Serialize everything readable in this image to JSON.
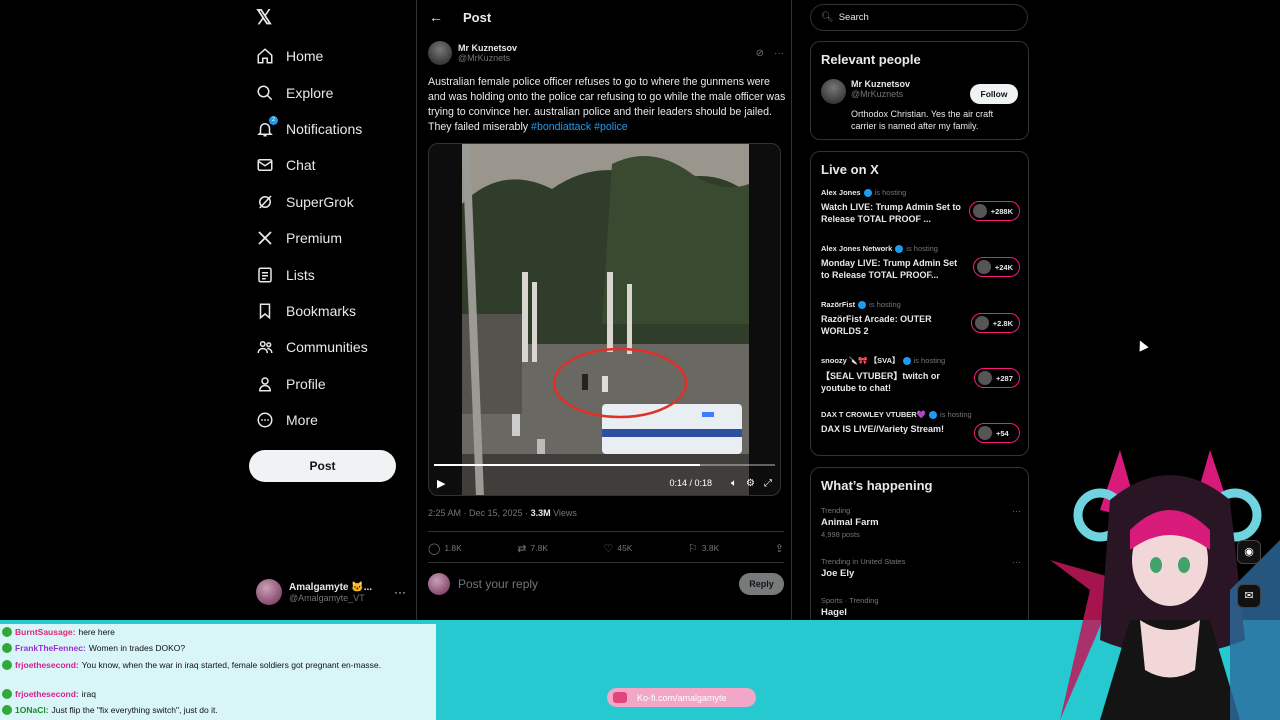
{
  "nav": {
    "logo": "𝕏",
    "items": [
      {
        "label": "Home",
        "icon": "home-icon"
      },
      {
        "label": "Explore",
        "icon": "search-icon"
      },
      {
        "label": "Notifications",
        "icon": "bell-icon",
        "badge": "2"
      },
      {
        "label": "Chat",
        "icon": "mail-icon"
      },
      {
        "label": "SuperGrok",
        "icon": "grok-icon"
      },
      {
        "label": "Premium",
        "icon": "x-icon"
      },
      {
        "label": "Lists",
        "icon": "list-icon"
      },
      {
        "label": "Bookmarks",
        "icon": "bookmark-icon"
      },
      {
        "label": "Communities",
        "icon": "people-icon"
      },
      {
        "label": "Profile",
        "icon": "person-icon"
      },
      {
        "label": "More",
        "icon": "more-circle-icon"
      }
    ],
    "post_button": "Post",
    "account": {
      "name": "Amalgamyte 🐱...",
      "handle": "@Amalgamyte_VT"
    }
  },
  "post": {
    "header_title": "Post",
    "author_name": "Mr Kuznetsov",
    "author_handle": "@MrKuznets",
    "text": "Australian female police officer refuses to go to where the gunmens were and was holding onto the police car refusing to go while the male officer was trying to convince her. australian police and their leaders should be jailed. They failed miserably ",
    "hashtags": [
      "#bondiattack",
      "#police"
    ],
    "video": {
      "time": "0:14 / 0:18",
      "progress": 0.78
    },
    "timestamp": "2:25 AM · Dec 15, 2025 · ",
    "views_count": "3.3M",
    "views_label": " Views",
    "stats": {
      "replies": "1.8K",
      "reposts": "7.8K",
      "likes": "45K",
      "bookmarks": "3.8K"
    },
    "reply_placeholder": "Post your reply",
    "reply_button": "Reply"
  },
  "search": {
    "placeholder": "Search"
  },
  "relevant_people": {
    "title": "Relevant people",
    "name": "Mr Kuznetsov",
    "handle": "@MrKuznets",
    "bio": "Orthodox Christian. Yes the air craft carrier is named after my family.",
    "follow": "Follow"
  },
  "live": {
    "title": "Live on X",
    "is_hosting": "is hosting",
    "items": [
      {
        "host": "Alex Jones",
        "title": "Watch LIVE: Trump Admin Set to Release TOTAL PROOF ...",
        "count": "+288K"
      },
      {
        "host": "Alex Jones Network",
        "title": "Monday LIVE: Trump Admin Set to Release TOTAL PROOF...",
        "count": "+24K"
      },
      {
        "host": "RazörFist",
        "title": "RazörFist Arcade: OUTER WORLDS 2",
        "count": "+2.8K"
      },
      {
        "host": "snoozy 🔪🎀 【SVA】",
        "title": "【SEAL VTUBER】twitch or youtube to chat!",
        "count": "+287"
      },
      {
        "host": "DAX T CROWLEY VTUBER💜",
        "title": "DAX IS LIVE//Variety Stream!",
        "count": "+54"
      }
    ]
  },
  "happening": {
    "title": "What’s happening",
    "trends": [
      {
        "context": "Trending",
        "name": "Animal Farm",
        "posts": "4,998 posts"
      },
      {
        "context": "Trending in United States",
        "name": "Joe Ely",
        "posts": ""
      },
      {
        "context": "Sports · Trending",
        "name": "Hagel",
        "posts": ""
      }
    ]
  },
  "chat": [
    {
      "user": "BurntSausage:",
      "msg": "here here",
      "color": "#e0267a"
    },
    {
      "user": "FrankTheFennec:",
      "msg": "Women in trades DOKO?",
      "color": "#9b2fd6"
    },
    {
      "user": "frjoethesecond:",
      "msg": "You know, when the war in iraq started, female soldiers got pregnant en-masse.",
      "color": "#d6218f"
    },
    {
      "user": "frjoethesecond:",
      "msg": "iraq",
      "color": "#d6218f"
    },
    {
      "user": "1ONaCl:",
      "msg": "Just flip the \"fix everything switch\", just do it.",
      "color": "#1a8a2a"
    }
  ],
  "kofi": "Ko-fi.com/amalgamyte",
  "colors": {
    "accent": "#1d9bf0",
    "live": "#f91880",
    "overlay": "#27c9d1"
  }
}
